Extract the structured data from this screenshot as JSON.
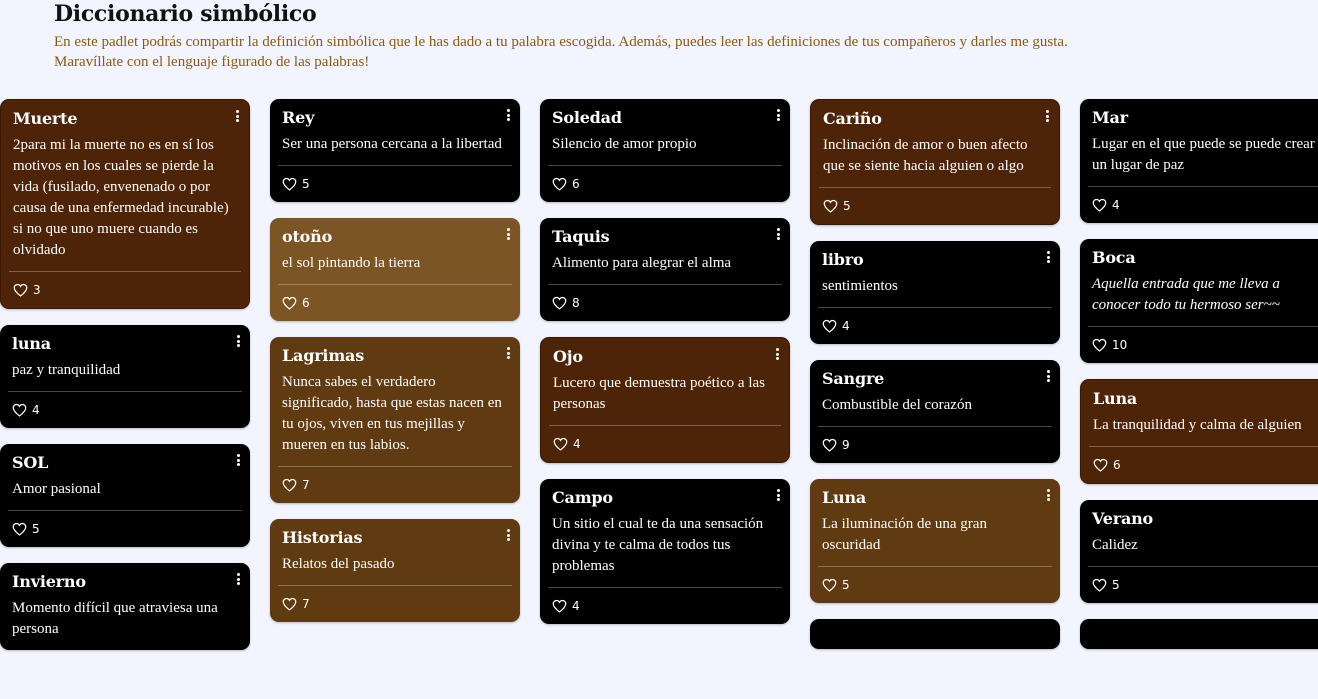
{
  "header": {
    "title": "Diccionario simbólico",
    "description_line1": "En este padlet podrás compartir la definición simbólica que le has dado a tu palabra escogida. Además, puedes leer las definiciones de tus compañeros y darles me gusta.",
    "description_line2": "Maravíllate con el lenguaje figurado de las palabras!"
  },
  "colors": {
    "background": "#f2f4ff",
    "title": "#121212",
    "description": "#8a5a10",
    "card_black": "#000000",
    "card_brown": "#4e2408",
    "card_tan": "#7c5524",
    "card_mid": "#603a10"
  },
  "icons": {
    "like": "heart-outline-icon",
    "menu": "vertical-dots-icon"
  },
  "columns": [
    {
      "cards": [
        {
          "title": "Muerte",
          "body": "2para mi la muerte no es en sí los motivos en los cuales se pierde la vida (fusilado, envenenado o por causa de una enfermedad incurable) si no que uno muere cuando es olvidado",
          "likes": "3",
          "style": "brown"
        },
        {
          "title": "luna",
          "body": "paz y tranquilidad",
          "likes": "4",
          "style": "black"
        },
        {
          "title": "SOL",
          "body": "Amor pasional",
          "likes": "5",
          "style": "black"
        },
        {
          "title": "Invierno",
          "body": "Momento difícil que atraviesa una persona",
          "likes": "",
          "style": "black"
        }
      ]
    },
    {
      "cards": [
        {
          "title": "Rey",
          "body": "Ser una persona cercana a la libertad",
          "likes": "5",
          "style": "black"
        },
        {
          "title": "otoño",
          "body": "el sol pintando la tierra",
          "likes": "6",
          "style": "tan"
        },
        {
          "title": "Lagrimas",
          "body": "Nunca sabes el verdadero significado, hasta que estas nacen en tu ojos, viven en tus mejillas y mueren en tus labios.",
          "likes": "7",
          "style": "mid"
        },
        {
          "title": "Historias",
          "body": "Relatos del pasado",
          "likes": "7",
          "style": "mid"
        }
      ]
    },
    {
      "cards": [
        {
          "title": "Soledad",
          "body": "Silencio de amor propio",
          "likes": "6",
          "style": "black"
        },
        {
          "title": "Taquis",
          "body": "Alimento para alegrar el alma",
          "likes": "8",
          "style": "black"
        },
        {
          "title": "Ojo",
          "body": "Lucero que demuestra poético a las personas",
          "likes": "4",
          "style": "brown"
        },
        {
          "title": "Campo",
          "body": "Un sitio el cual te da una sensación divina y te calma de todos tus problemas",
          "likes": "4",
          "style": "black"
        }
      ]
    },
    {
      "cards": [
        {
          "title": "Cariño",
          "body": "Inclinación de amor o buen afecto que se siente hacia alguien o algo",
          "likes": "5",
          "style": "brown"
        },
        {
          "title": "libro",
          "body": "sentimientos",
          "likes": "4",
          "style": "black"
        },
        {
          "title": "Sangre",
          "body": "Combustible del corazón",
          "likes": "9",
          "style": "black"
        },
        {
          "title": "Luna",
          "body": "La iluminación de una gran oscuridad",
          "likes": "5",
          "style": "mid"
        }
      ]
    },
    {
      "cards": [
        {
          "title": "Mar",
          "body": "Lugar en el que puede se puede crear un lugar de paz",
          "likes": "4",
          "style": "black"
        },
        {
          "title": "Boca",
          "body": "Aquella entrada que me lleva a conocer todo tu hermoso ser~~",
          "likes": "10",
          "style": "black",
          "italic": true
        },
        {
          "title": "Luna",
          "body": "La tranquilidad y calma de alguien",
          "likes": "6",
          "style": "brown"
        },
        {
          "title": "Verano",
          "body": "Calidez",
          "likes": "5",
          "style": "black"
        }
      ]
    }
  ]
}
